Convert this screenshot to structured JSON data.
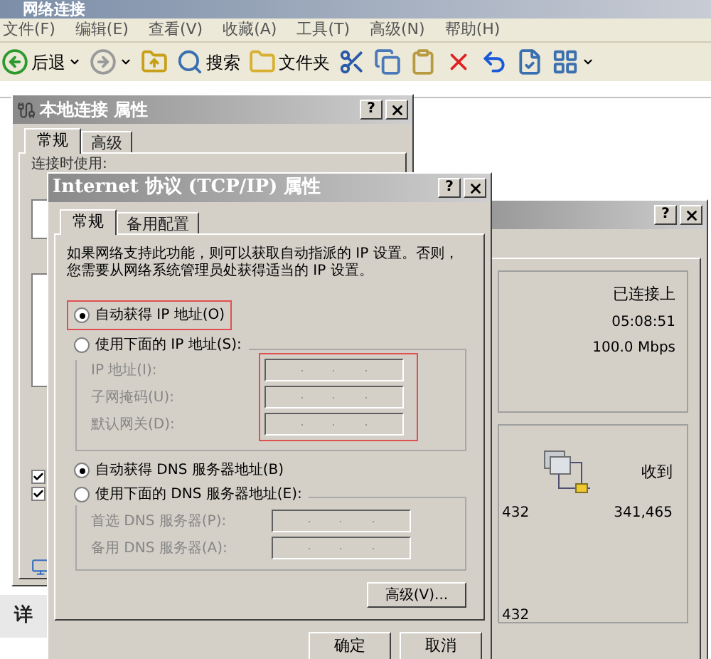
{
  "explorer": {
    "title": "网络连接",
    "menu": [
      "文件(F)",
      "编辑(E)",
      "查看(V)",
      "收藏(A)",
      "工具(T)",
      "高级(N)",
      "帮助(H)"
    ],
    "toolbar": [
      {
        "kind": "back",
        "label": "后退"
      },
      {
        "kind": "forward"
      },
      {
        "kind": "up"
      },
      {
        "kind": "search",
        "label": "搜索"
      },
      {
        "kind": "folders",
        "label": "文件夹"
      },
      {
        "kind": "cut"
      },
      {
        "kind": "copy"
      },
      {
        "kind": "paste"
      },
      {
        "kind": "delete"
      },
      {
        "kind": "undo"
      },
      {
        "kind": "properties"
      },
      {
        "kind": "views"
      }
    ],
    "side_text": "详"
  },
  "help_glyph": "?",
  "local_dialog": {
    "title": "本地连接 属性",
    "tabs": [
      {
        "label": "常规",
        "selected": true
      },
      {
        "label": "高级",
        "selected": false
      }
    ],
    "connect_using": "连接时使用:",
    "checkboxes": [
      {
        "checked": true
      },
      {
        "checked": true
      }
    ]
  },
  "status_dialog": {
    "status": "已连接上",
    "duration": "05:08:51",
    "speed": "100.0 Mbps",
    "received_label": "收到",
    "sent_packets": "432",
    "received_packets": "341,465",
    "extra": "432"
  },
  "tcpip_dialog": {
    "title": "Internet 协议 (TCP/IP) 属性",
    "tabs": [
      {
        "label": "常规",
        "selected": true
      },
      {
        "label": "备用配置",
        "selected": false
      }
    ],
    "intro": "如果网络支持此功能，则可以获取自动指派的 IP 设置。否则，您需要从网络系统管理员处获得适当的 IP 设置。",
    "ip_mode": [
      {
        "label": "自动获得 IP 地址(O)",
        "selected": true,
        "highlighted": true
      },
      {
        "label": "使用下面的 IP 地址(S):",
        "selected": false,
        "highlighted": false
      }
    ],
    "ip_fields_highlighted": true,
    "ip_fields": [
      {
        "label": "IP 地址(I):",
        "disabled": true
      },
      {
        "label": "子网掩码(U):",
        "disabled": true
      },
      {
        "label": "默认网关(D):",
        "disabled": true
      }
    ],
    "dns_mode": [
      {
        "label": "自动获得 DNS 服务器地址(B)",
        "selected": true
      },
      {
        "label": "使用下面的 DNS 服务器地址(E):",
        "selected": false
      }
    ],
    "dns_fields": [
      {
        "label": "首选 DNS 服务器(P):",
        "disabled": true
      },
      {
        "label": "备用 DNS 服务器(A):",
        "disabled": true
      }
    ],
    "advanced_button": "高级(V)...",
    "buttons": [
      "确定",
      "取消"
    ]
  }
}
